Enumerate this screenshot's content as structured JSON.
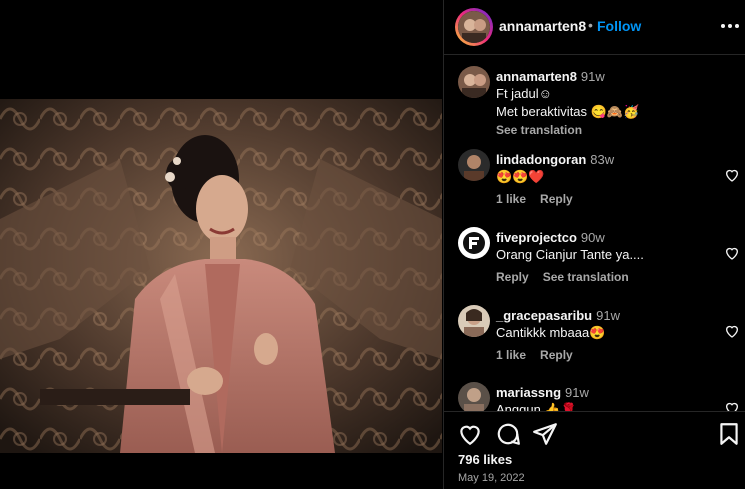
{
  "post": {
    "username": "annamarten8",
    "follow_label": "Follow",
    "separator": "•",
    "likes": "796 likes",
    "date": "May 19, 2022"
  },
  "comments": [
    {
      "username": "annamarten8",
      "time": "91w",
      "lines": [
        "Ft jadul☺",
        "Met beraktivitas 😋🙈🥳"
      ],
      "actions": [
        "See translation"
      ]
    },
    {
      "username": "lindadongoran",
      "time": "83w",
      "lines": [
        "😍😍❤️"
      ],
      "actions": [
        "1 like",
        "Reply"
      ]
    },
    {
      "username": "fiveprojectco",
      "time": "90w",
      "lines": [
        "Orang Cianjur Tante ya...."
      ],
      "actions": [
        "Reply",
        "See translation"
      ]
    },
    {
      "username": "_gracepasaribu",
      "time": "91w",
      "lines": [
        "Cantikkk mbaaa😍"
      ],
      "actions": [
        "1 like",
        "Reply"
      ]
    },
    {
      "username": "mariassng",
      "time": "91w",
      "lines": [
        "Anggun 👍🌹"
      ],
      "actions": []
    }
  ],
  "icons": {
    "more": "more-options-icon",
    "like": "heart-icon",
    "comment": "comment-icon",
    "share": "share-icon",
    "save": "bookmark-icon"
  }
}
